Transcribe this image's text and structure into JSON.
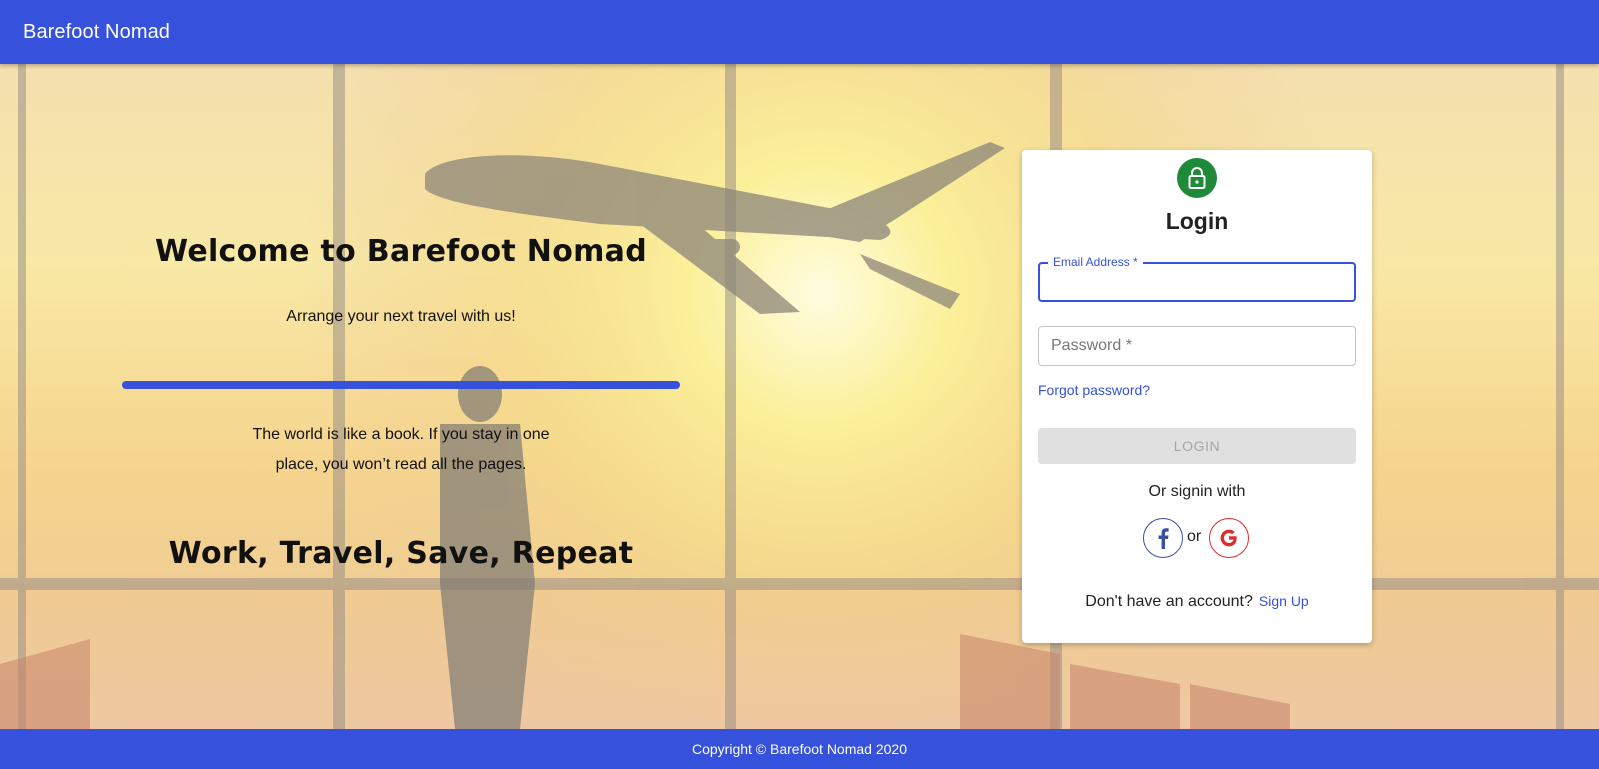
{
  "appbar": {
    "brand": "Barefoot Nomad"
  },
  "hero": {
    "welcome": "Welcome to Barefoot Nomad",
    "tagline": "Arrange your next travel with us!",
    "quote": "The world is like a book. If you stay in one place, you won’t read all the pages.",
    "motto": "Work, Travel, Save, Repeat"
  },
  "login": {
    "icon": "lock-icon",
    "title": "Login",
    "email_label": "Email Address *",
    "email_value": "",
    "password_placeholder": "Password *",
    "password_value": "",
    "forgot": "Forgot password?",
    "submit": "LOGIN",
    "or_signin": "Or signin with",
    "or": "or",
    "facebook_icon": "facebook-icon",
    "google_icon": "google-icon",
    "no_account": "Don't have an account?",
    "signup": "Sign Up"
  },
  "footer": {
    "copyright": "Copyright © Barefoot Nomad 2020"
  },
  "colors": {
    "primary": "#3651db",
    "lock_bg": "#1f8a3a",
    "facebook": "#3b4fa0",
    "google": "#e02b2b"
  }
}
